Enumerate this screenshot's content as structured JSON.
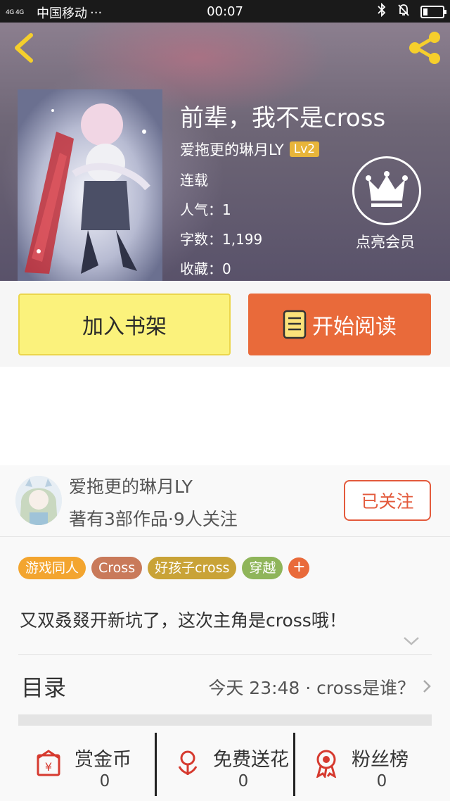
{
  "status_bar": {
    "network": "4G 4G",
    "carrier": "中国移动",
    "dots": "···",
    "time": "00:07",
    "battery_level": 0.2
  },
  "book": {
    "title": "前辈，我不是cross",
    "author": "爱拖更的琳月LY",
    "level": "Lv2",
    "status": "连载",
    "popularity": "人气：1",
    "word_count": "字数：1,199",
    "favorites": "收藏：0"
  },
  "vip": {
    "label": "点亮会员"
  },
  "actions": {
    "add_shelf": "加入书架",
    "start_read": "开始阅读"
  },
  "author_card": {
    "name": "爱拖更的琳月LY",
    "stats": "著有3部作品·9人关注",
    "follow_label": "已关注"
  },
  "tags": [
    {
      "label": "游戏同人",
      "color": "#f3a52f"
    },
    {
      "label": "Cross",
      "color": "#c97a5a"
    },
    {
      "label": "好孩子cross",
      "color": "#c9a337"
    },
    {
      "label": "穿越",
      "color": "#8fb55a"
    }
  ],
  "tag_add": "+",
  "description": "又双叒叕开新坑了，这次主角是cross哦！",
  "toc": {
    "title": "目录",
    "latest": "今天 23:48 · cross是谁？"
  },
  "stats": [
    {
      "label": "赏金币",
      "value": "0",
      "icon": "coin-envelope-icon"
    },
    {
      "label": "免费送花",
      "value": "0",
      "icon": "flower-icon"
    },
    {
      "label": "粉丝榜",
      "value": "0",
      "icon": "medal-icon"
    }
  ],
  "colors": {
    "accent_orange": "#e96a3a",
    "shelf_yellow": "#fbf27c",
    "follow_red": "#e35a3c",
    "icon_yellow": "#f5cf2c"
  }
}
